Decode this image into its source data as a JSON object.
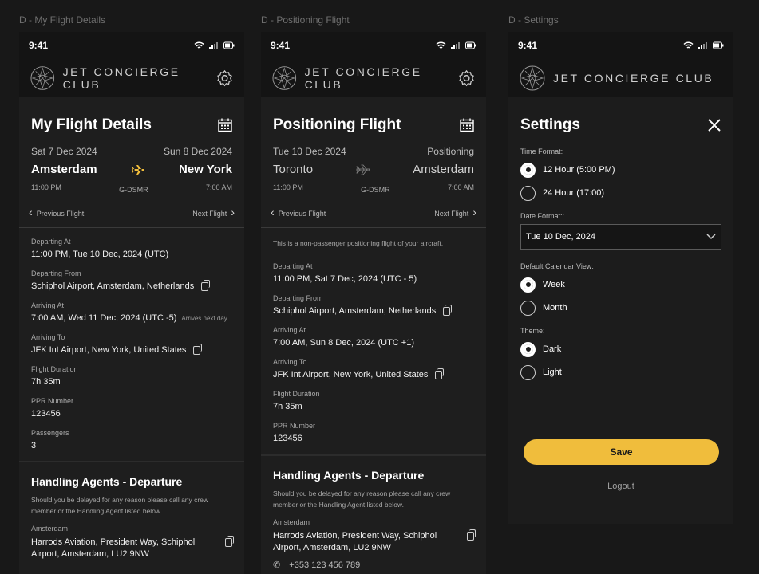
{
  "frames": {
    "f1": "D - My Flight Details",
    "f2": "D - Positioning Flight",
    "f3": "D - Settings"
  },
  "status": {
    "time": "9:41"
  },
  "brand": "JET CONCIERGE CLUB",
  "colors": {
    "accent": "#f0bd3c",
    "background": "#1e1e1e",
    "header": "#141414"
  },
  "flight": {
    "title": "My Flight Details",
    "dep_date": "Sat 7 Dec 2024",
    "arr_date": "Sun 8 Dec 2024",
    "from_city": "Amsterdam",
    "to_city": "New York",
    "dep_time": "11:00 PM",
    "reg": "G-DSMR",
    "arr_time": "7:00 AM",
    "prev": "Previous Flight",
    "next": "Next Flight",
    "details": [
      {
        "label": "Departing At",
        "value": "11:00 PM, Tue 10 Dec, 2024 (UTC)",
        "copy": false,
        "note": ""
      },
      {
        "label": "Departing From",
        "value": "Schiphol Airport, Amsterdam, Netherlands",
        "copy": true,
        "note": ""
      },
      {
        "label": "Arriving At",
        "value": "7:00 AM, Wed 11 Dec, 2024 (UTC -5)",
        "copy": false,
        "note": "Arrives next day"
      },
      {
        "label": "Arriving To",
        "value": "JFK Int Airport, New York, United States",
        "copy": true,
        "note": ""
      },
      {
        "label": "Flight Duration",
        "value": "7h 35m",
        "copy": false,
        "note": ""
      },
      {
        "label": "PPR Number",
        "value": "123456",
        "copy": false,
        "note": ""
      },
      {
        "label": "Passengers",
        "value": "3",
        "copy": false,
        "note": ""
      }
    ],
    "agents_title": "Handling Agents - Departure",
    "agents_text": "Should you be delayed for any reason please call any crew member or the Handling Agent listed below.",
    "agent_city": "Amsterdam",
    "agent_address": "Harrods Aviation, President Way, Schiphol Airport, Amsterdam, LU2 9NW"
  },
  "positioning": {
    "title": "Positioning Flight",
    "dep_date": "Tue 10 Dec 2024",
    "arr_tag": "Positioning",
    "from_city": "Toronto",
    "to_city": "Amsterdam",
    "dep_time": "11:00 PM",
    "reg": "G-DSMR",
    "arr_time": "7:00 AM",
    "prev": "Previous Flight",
    "next": "Next Flight",
    "notice": "This is a non-passenger positioning flight of your aircraft.",
    "details": [
      {
        "label": "Departing At",
        "value": "11:00 PM, Sat 7 Dec, 2024 (UTC - 5)",
        "copy": false
      },
      {
        "label": "Departing From",
        "value": "Schiphol Airport, Amsterdam, Netherlands",
        "copy": true
      },
      {
        "label": "Arriving At",
        "value": "7:00 AM, Sun 8 Dec, 2024 (UTC +1)",
        "copy": false
      },
      {
        "label": "Arriving To",
        "value": "JFK Int Airport, New York, United States",
        "copy": true
      },
      {
        "label": "Flight Duration",
        "value": "7h 35m",
        "copy": false
      },
      {
        "label": "PPR Number",
        "value": "123456",
        "copy": false
      }
    ],
    "agents_title": "Handling Agents - Departure",
    "agents_text": "Should you be delayed for any reason please call any crew member or the Handling Agent listed below.",
    "agent_city": "Amsterdam",
    "agent_address": "Harrods Aviation, President Way, Schiphol Airport, Amsterdam, LU2 9NW",
    "agent_phone": "+353 123 456 789"
  },
  "settings": {
    "title": "Settings",
    "time_label": "Time Format:",
    "time_12": "12 Hour (5:00 PM)",
    "time_24": "24 Hour (17:00)",
    "date_label": "Date Format::",
    "date_value": "Tue 10 Dec, 2024",
    "cal_label": "Default Calendar View:",
    "cal_week": "Week",
    "cal_month": "Month",
    "theme_label": "Theme:",
    "theme_dark": "Dark",
    "theme_light": "Light",
    "save": "Save",
    "logout": "Logout"
  }
}
